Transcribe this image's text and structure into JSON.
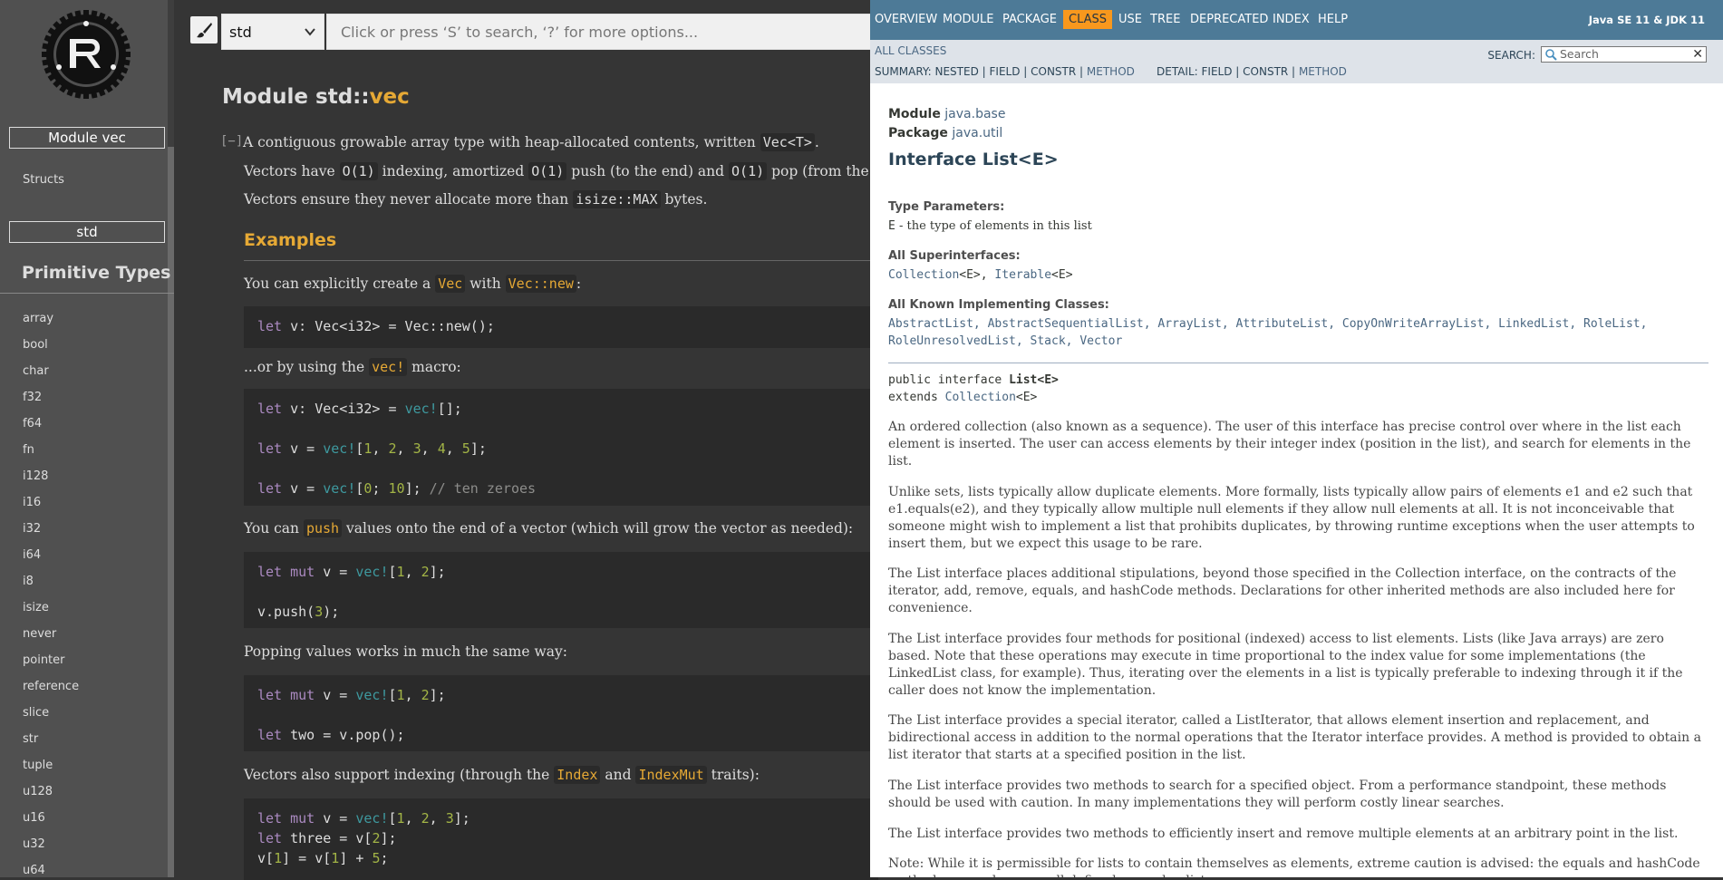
{
  "rust": {
    "sidebar": {
      "module_box": "Module vec",
      "structs_link": "Structs",
      "crate_box": "std",
      "primitive_heading": "Primitive Types",
      "primitives": [
        "array",
        "bool",
        "char",
        "f32",
        "f64",
        "fn",
        "i128",
        "i16",
        "i32",
        "i64",
        "i8",
        "isize",
        "never",
        "pointer",
        "reference",
        "slice",
        "str",
        "tuple",
        "u128",
        "u16",
        "u32",
        "u64"
      ]
    },
    "topbar": {
      "crate_selected": "std",
      "search_placeholder": "Click or press ‘S’ to search, ‘?’ for more options..."
    },
    "main": {
      "title_prefix": "Module std::",
      "title_name": "vec",
      "toggle": "[−]",
      "intro": "A contiguous growable array type with heap-allocated contents, written",
      "intro_code": "Vec<T>",
      "p2_a": "Vectors have",
      "p2_c1": "O(1)",
      "p2_b": "indexing, amortized",
      "p2_c2": "O(1)",
      "p2_d": "push (to the end) and",
      "p2_c3": "O(1)",
      "p2_e": "pop (from the end).",
      "p3_a": "Vectors ensure they never allocate more than",
      "p3_code": "isize::MAX",
      "p3_b": "bytes.",
      "examples_heading": "Examples",
      "ex1_a": "You can explicitly create a",
      "ex1_code1": "Vec",
      "ex1_b": "with",
      "ex1_code2": "Vec::new",
      "ex1_c": ":",
      "ex2_a": "...or by using the",
      "ex2_code": "vec!",
      "ex2_b": "macro:",
      "ex3_a": "You can",
      "ex3_code": "push",
      "ex3_b": "values onto the end of a vector (which will grow the vector as needed):",
      "ex4": "Popping values works in much the same way:",
      "ex5_a": "Vectors also support indexing (through the",
      "ex5_code1": "Index",
      "ex5_b": "and",
      "ex5_code2": "IndexMut",
      "ex5_c": "traits):"
    }
  },
  "javadoc": {
    "nav": [
      "OVERVIEW",
      "MODULE",
      "PACKAGE",
      "CLASS",
      "USE",
      "TREE",
      "DEPRECATED",
      "INDEX",
      "HELP"
    ],
    "version": "Java SE 11 & JDK 11",
    "all_classes": "ALL CLASSES",
    "summary_label": "SUMMARY:",
    "summary_items": "NESTED | FIELD | CONSTR |",
    "summary_method": "METHOD",
    "detail_label": "DETAIL:",
    "detail_items": "FIELD | CONSTR |",
    "detail_method": "METHOD",
    "search_label": "SEARCH:",
    "search_placeholder": "Search",
    "module_label": "Module",
    "module_value": "java.base",
    "package_label": "Package",
    "package_value": "java.util",
    "title": "Interface List<E>",
    "type_params_label": "Type Parameters:",
    "type_params_code": "E",
    "type_params_desc": "- the type of elements in this list",
    "superinterfaces_label": "All Superinterfaces:",
    "superinterfaces_1": "Collection",
    "superinterfaces_1g": "<E>,",
    "superinterfaces_2": "Iterable",
    "superinterfaces_2g": "<E>",
    "impl_label": "All Known Implementing Classes:",
    "impl_line1": "AbstractList, AbstractSequentialList, ArrayList, AttributeList, CopyOnWriteArrayList, LinkedList, RoleList,",
    "impl_line2": "RoleUnresolvedList, Stack, Vector",
    "sig_1a": "public interface",
    "sig_1b": "List<E>",
    "sig_2a": "extends",
    "sig_2b": "Collection",
    "sig_2c": "<E>",
    "para1": "An ordered collection (also known as a sequence). The user of this interface has precise control over where in the list each element is inserted. The user can access elements by their integer index (position in the list), and search for elements in the list.",
    "para2": "Unlike sets, lists typically allow duplicate elements. More formally, lists typically allow pairs of elements e1 and e2 such that e1.equals(e2), and they typically allow multiple null elements if they allow null elements at all. It is not inconceivable that someone might wish to implement a list that prohibits duplicates, by throwing runtime exceptions when the user attempts to insert them, but we expect this usage to be rare.",
    "para3": "The List interface places additional stipulations, beyond those specified in the Collection interface, on the contracts of the iterator, add, remove, equals, and hashCode methods. Declarations for other inherited methods are also included here for convenience.",
    "para4": "The List interface provides four methods for positional (indexed) access to list elements. Lists (like Java arrays) are zero based. Note that these operations may execute in time proportional to the index value for some implementations (the LinkedList class, for example). Thus, iterating over the elements in a list is typically preferable to indexing through it if the caller does not know the implementation.",
    "para5": "The List interface provides a special iterator, called a ListIterator, that allows element insertion and replacement, and bidirectional access in addition to the normal operations that the Iterator interface provides. A method is provided to obtain a list iterator that starts at a specified position in the list.",
    "para6": "The List interface provides two methods to search for a specified object. From a performance standpoint, these methods should be used with caution. In many implementations they will perform costly linear searches.",
    "para7": "The List interface provides two methods to efficiently insert and remove multiple elements at an arbitrary point in the list.",
    "para8": "Note: While it is permissible for lists to contain themselves as elements, extreme caution is advised: the equals and hashCode methods are no longer well defined on such a list."
  }
}
